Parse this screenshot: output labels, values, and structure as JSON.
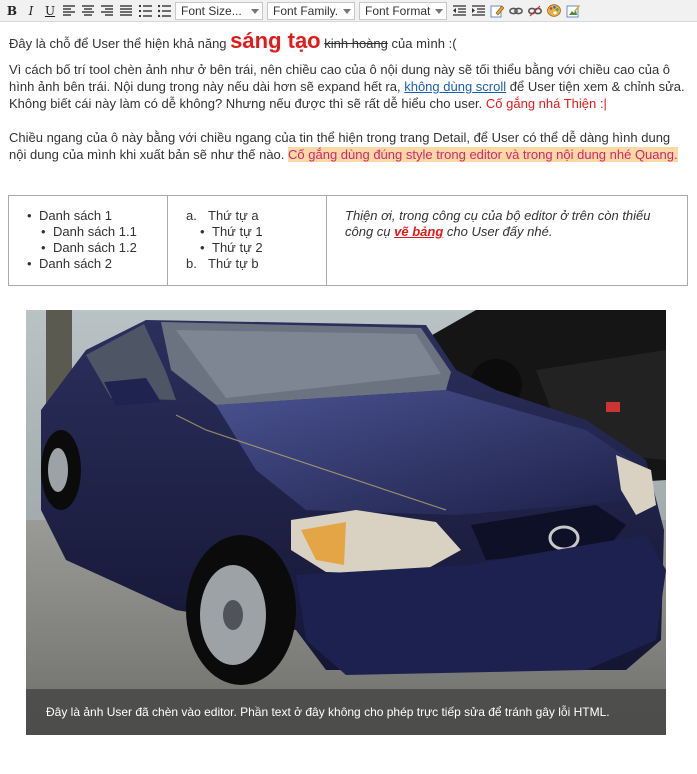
{
  "toolbar": {
    "bold": "B",
    "italic": "I",
    "underline": "U",
    "font_size": "Font Size...",
    "font_family": "Font Family.",
    "font_format": "Font Format"
  },
  "content": {
    "p1": {
      "prefix": "Đây là chỗ để User thể hiện khả năng",
      "emphasis": "sáng tạo",
      "strike": "kinh hoàng",
      "suffix": "của mình :("
    },
    "p2": {
      "text1": "Vì cách bố trí tool chèn ảnh như ở bên trái, nên chiều cao của ô nội dung này sẽ tối thiểu bằng với chiều cao của ô hình ảnh bên trái. Nội dung trong này nếu dài hơn sẽ expand hết ra,",
      "link": "không dùng scroll",
      "text2": "để User tiện xem & chỉnh sửa. Không biết cái này làm có dễ không? Nhưng nếu được thì sẽ rất dễ hiểu cho user.",
      "red": "Cố gắng nhá Thiện :|"
    },
    "p3": {
      "text": "Chiều ngang của ô này bằng với chiều ngang của tin thể hiện trong trang Detail, để User có thể dễ dàng hình dung nội dung của mình khi xuất bản sẽ như thế nào.",
      "highlight": "Cố gắng dùng đúng style trong editor và trong nội dung nhé Quang."
    }
  },
  "table": {
    "bullets": {
      "item1": "Danh sách 1",
      "item1_1": "Danh sách 1.1",
      "item1_2": "Danh sách 1.2",
      "item2": "Danh sách 2"
    },
    "ordered": {
      "a_mark": "a.",
      "a": "Thứ tự a",
      "a1": "Thứ tự 1",
      "a2": "Thứ tự 2",
      "b_mark": "b.",
      "b": "Thứ tự b"
    },
    "note": {
      "text1": "Thiện ơi, trong công cụ của bộ editor ở trên còn thiếu công cụ",
      "emph": "vẽ bảng",
      "text2": "cho User đấy nhé."
    }
  },
  "image": {
    "caption": "Đây là ảnh User đã chèn vào editor. Phần text ở đây không cho phép trực tiếp sửa để tránh gây lỗi HTML."
  }
}
